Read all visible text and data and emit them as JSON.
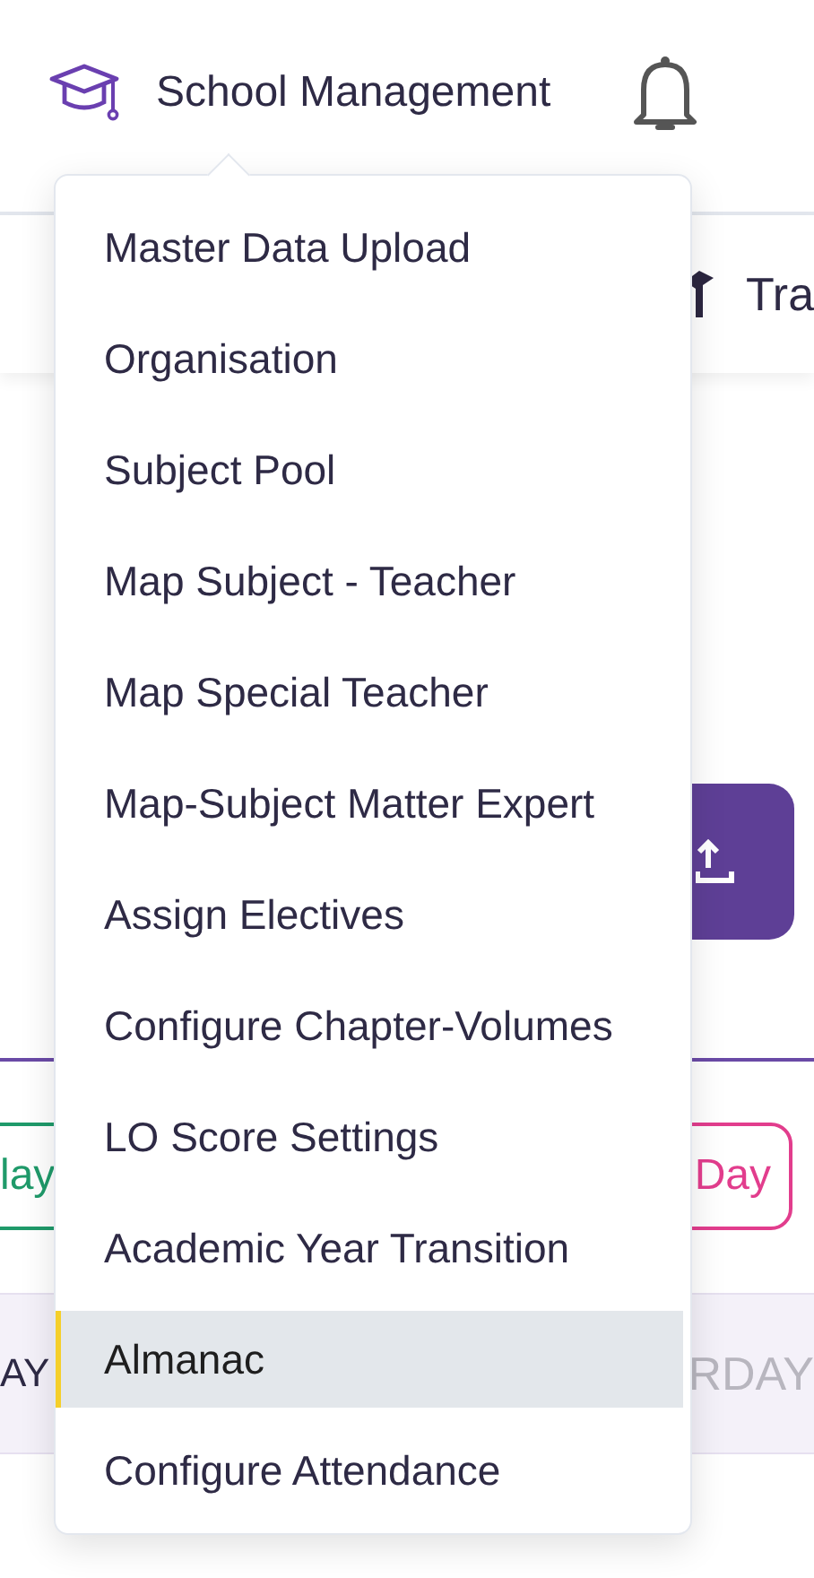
{
  "header": {
    "title": "School Management"
  },
  "background": {
    "card_text": "Tra",
    "green_chip": "lay",
    "pink_chip": "Day",
    "day_left": "AY",
    "day_right": "RDAY"
  },
  "menu": {
    "items": [
      {
        "label": "Master Data Upload",
        "selected": false
      },
      {
        "label": "Organisation",
        "selected": false
      },
      {
        "label": "Subject Pool",
        "selected": false
      },
      {
        "label": "Map Subject - Teacher",
        "selected": false
      },
      {
        "label": "Map Special Teacher",
        "selected": false
      },
      {
        "label": "Map-Subject Matter Expert",
        "selected": false
      },
      {
        "label": "Assign Electives",
        "selected": false
      },
      {
        "label": "Configure Chapter-Volumes",
        "selected": false
      },
      {
        "label": "LO Score Settings",
        "selected": false
      },
      {
        "label": "Academic Year Transition",
        "selected": false
      },
      {
        "label": "Almanac",
        "selected": true
      },
      {
        "label": "Configure Attendance",
        "selected": false
      }
    ]
  }
}
